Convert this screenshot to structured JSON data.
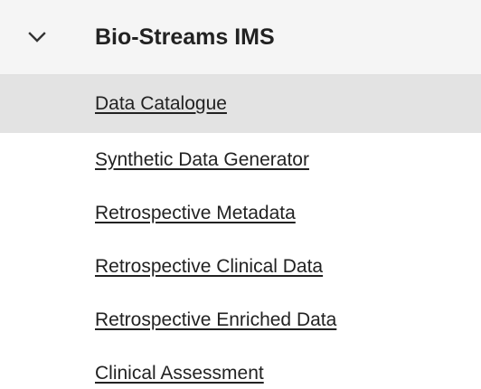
{
  "section": {
    "title": "Bio-Streams IMS",
    "expanded": true,
    "chevron_icon": "chevron-down-icon"
  },
  "items": [
    {
      "label": "Data Catalogue",
      "active": true
    },
    {
      "label": "Synthetic Data Generator",
      "active": false
    },
    {
      "label": "Retrospective Metadata",
      "active": false
    },
    {
      "label": "Retrospective Clinical Data",
      "active": false
    },
    {
      "label": "Retrospective Enriched Data",
      "active": false
    },
    {
      "label": "Clinical Assessment",
      "active": false
    }
  ],
  "colors": {
    "header_bg": "#f5f5f5",
    "active_bg": "#e3e3e3",
    "text": "#222222"
  }
}
